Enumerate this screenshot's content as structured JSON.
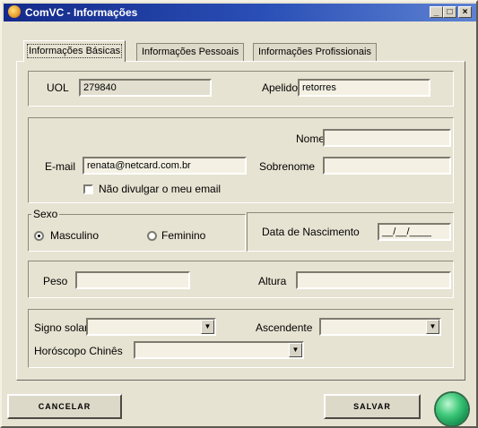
{
  "window": {
    "title": "ComVC - Informações",
    "controls": [
      "_",
      "□",
      "×"
    ]
  },
  "tabs": [
    "Informações Básicas",
    "Informações Pessoais",
    "Informações Profissionais"
  ],
  "basic": {
    "uol_label": "UOL",
    "uol_value": "279840",
    "apelido_label": "Apelido",
    "apelido_value": "retorres"
  },
  "contact": {
    "nome_label": "Nome",
    "nome_value": "",
    "email_label": "E-mail",
    "email_value": "renata@netcard.com.br",
    "sobrenome_label": "Sobrenome",
    "sobrenome_value": "",
    "hide_email_label": "Não divulgar o meu email",
    "hide_email_checked": false
  },
  "sexo": {
    "title": "Sexo",
    "options": [
      "Masculino",
      "Feminino"
    ],
    "selected": "Masculino"
  },
  "nascimento": {
    "label": "Data de Nascimento",
    "value": "__/__/____"
  },
  "medidas": {
    "peso_label": "Peso",
    "peso_value": "",
    "altura_label": "Altura",
    "altura_value": ""
  },
  "astro": {
    "signo_label": "Signo solar",
    "signo_value": "",
    "ascendente_label": "Ascendente",
    "ascendente_value": "",
    "chines_label": "Horóscopo Chinês",
    "chines_value": ""
  },
  "footer": {
    "cancel_label": "CANCELAR",
    "save_label": "SALVAR"
  },
  "colors": {
    "titlebar": "#142a8a",
    "face": "#e7e3d2",
    "status": "#3fc87a"
  }
}
